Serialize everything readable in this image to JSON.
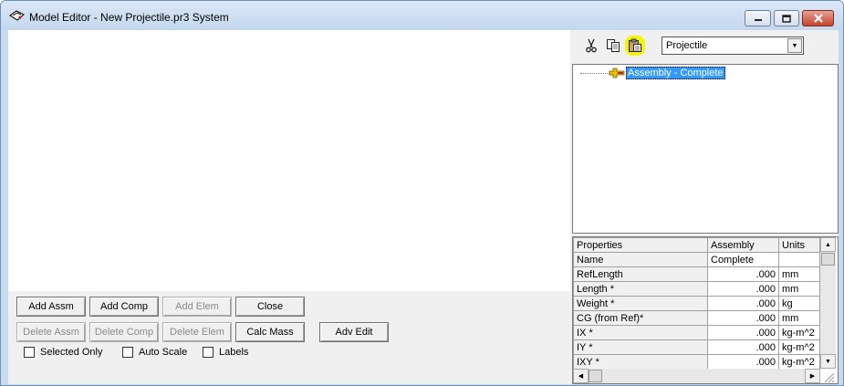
{
  "window": {
    "title": "Model Editor - New Projectile.pr3 System",
    "buttons": [
      "minimize-icon",
      "maximize-icon",
      "close-icon"
    ]
  },
  "toolbar": {
    "icons": [
      "cut-icon",
      "copy-icon",
      "paste-icon"
    ],
    "dropdown_value": "Projectile"
  },
  "tree": {
    "items": [
      {
        "label": "Assembly - Complete",
        "icon": "assembly-icon",
        "selected": true
      }
    ]
  },
  "properties": {
    "headers": [
      "Properties",
      "Assembly",
      "Units"
    ],
    "rows": [
      {
        "name": "Name",
        "value": "Complete",
        "unit": ""
      },
      {
        "name": "RefLength",
        "value": ".000",
        "unit": "mm"
      },
      {
        "name": "Length *",
        "value": ".000",
        "unit": "mm"
      },
      {
        "name": "Weight *",
        "value": ".000",
        "unit": "kg"
      },
      {
        "name": "CG (from Ref)*",
        "value": ".000",
        "unit": "mm"
      },
      {
        "name": "IX *",
        "value": ".000",
        "unit": "kg-m^2"
      },
      {
        "name": "IY *",
        "value": ".000",
        "unit": "kg-m^2"
      },
      {
        "name": "IXY *",
        "value": ".000",
        "unit": "kg-m^2"
      }
    ]
  },
  "buttons": {
    "add_assm": "Add Assm",
    "add_comp": "Add Comp",
    "add_elem": "Add Elem",
    "close": "Close",
    "delete_assm": "Delete Assm",
    "delete_comp": "Delete Comp",
    "delete_elem": "Delete Elem",
    "calc_mass": "Calc Mass",
    "adv_edit": "Adv Edit"
  },
  "options": {
    "selected_only": "Selected Only",
    "auto_scale": "Auto Scale",
    "labels": "Labels"
  },
  "colors": {
    "selection": "#3399ff",
    "highlight": "#f5f50a"
  }
}
